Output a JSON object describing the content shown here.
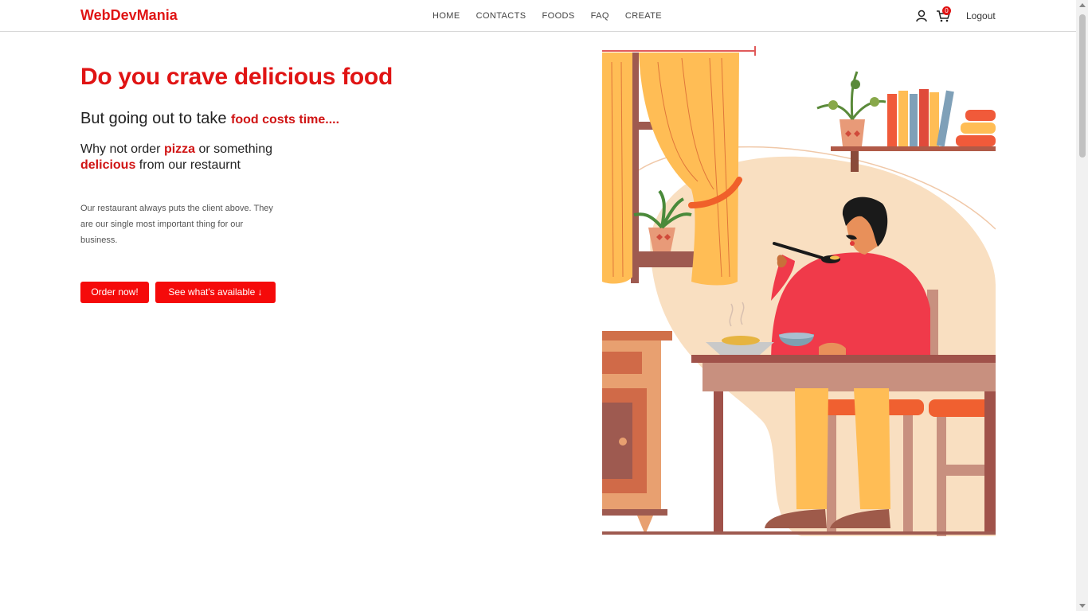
{
  "navbar": {
    "brand": "WebDevMania",
    "links": [
      "HOME",
      "CONTACTS",
      "FOODS",
      "FAQ",
      "CREATE"
    ],
    "cart_count": "0",
    "logout_label": "Logout",
    "user_icon": "user-icon",
    "cart_icon": "cart-icon"
  },
  "hero": {
    "title": "Do you crave delicious food",
    "sub_prefix": "But going out to take ",
    "sub_emphasis": "food costs time....",
    "p2_a": "Why not order ",
    "p2_b": "pizza",
    "p2_c": " or something",
    "p2_d": "delicious",
    "p2_e": " from our restaurnt",
    "description": "Our restaurant always puts the client above. They are our single most important thing for our business.",
    "order_button": "Order now!",
    "available_button": "See what's available ↓"
  },
  "colors": {
    "accent": "#e01414",
    "button": "#f50a0a"
  }
}
